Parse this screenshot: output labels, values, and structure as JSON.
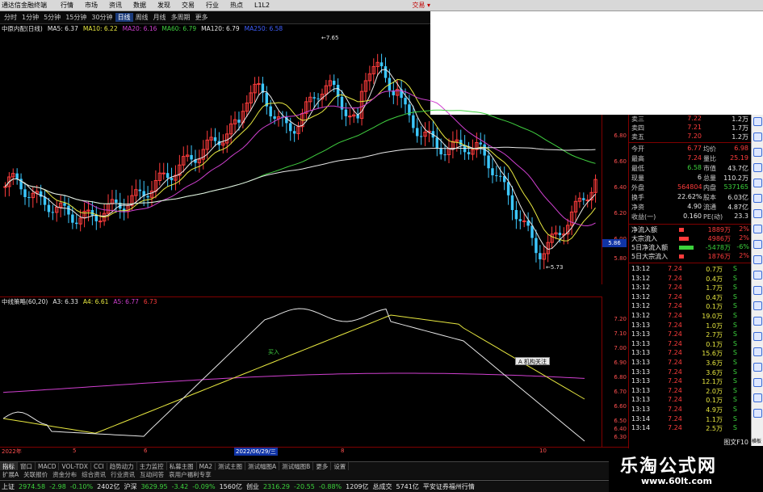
{
  "menubar": {
    "app_title": "通达信金融终端",
    "items": [
      "行情",
      "市场",
      "资讯",
      "数据",
      "发现",
      "交易",
      "行业",
      "热点",
      "L1L2"
    ],
    "right_label": "交易 ▾"
  },
  "periodbar": {
    "items": [
      "分时",
      "1分钟",
      "5分钟",
      "15分钟",
      "30分钟",
      "日线",
      "周线",
      "月线",
      "多周期",
      "更多"
    ],
    "active": "日线"
  },
  "main_legend": [
    {
      "text": "中原内配(日线)",
      "color": "#e8e8e8"
    },
    {
      "text": "MA5: 6.37",
      "color": "#e8e8e8"
    },
    {
      "text": "MA10: 6.22",
      "color": "#e8e840"
    },
    {
      "text": "MA20: 6.16",
      "color": "#d040d0"
    },
    {
      "text": "MA60: 6.79",
      "color": "#40d040"
    },
    {
      "text": "MA120: 6.79",
      "color": "#e8e8e8"
    },
    {
      "text": "MA250: 6.58",
      "color": "#4060ff"
    }
  ],
  "price_axis": [
    "6.80",
    "6.60",
    "6.40",
    "6.20",
    "6.00",
    "5.80"
  ],
  "price_current": "5.86",
  "annotations": {
    "high": "7.65",
    "low": "5.73"
  },
  "indicator_legend": [
    {
      "text": "中线策略(60,20)",
      "color": "#e8e8e8"
    },
    {
      "text": "A3: 6.33",
      "color": "#e8e8e8"
    },
    {
      "text": "A4: 6.61",
      "color": "#e8e840"
    },
    {
      "text": "A5: 6.77",
      "color": "#d040d0"
    },
    {
      "text": "6.73",
      "color": "#ff3c3c"
    }
  ],
  "indicator_axis": [
    "7.20",
    "7.10",
    "7.00",
    "6.90",
    "6.80",
    "6.70",
    "6.60",
    "6.50",
    "6.40",
    "6.30"
  ],
  "indicator_label": "买入",
  "popup_label": "A 机构关注",
  "date_axis": [
    {
      "text": "2022年",
      "highlight": false
    },
    {
      "text": "5",
      "highlight": false
    },
    {
      "text": "6",
      "highlight": false
    },
    {
      "text": "2022/06/29/三",
      "highlight": true
    },
    {
      "text": "8",
      "highlight": false
    },
    {
      "text": "10",
      "highlight": false
    }
  ],
  "tabbar1": [
    "指标",
    "窗口",
    "MACD",
    "VOL-TDX",
    "CCI",
    "趋势动力",
    "主力监控",
    "私募主图",
    "MA2",
    "测试主图",
    "测试幅图A",
    "测试幅图B",
    "更多",
    "设置"
  ],
  "tabbar2": [
    "扩展A",
    "关联报价",
    "资金分布",
    "综合资讯",
    "行业资讯",
    "互动问答",
    "哀用户福利专享"
  ],
  "quote": {
    "asks": [
      {
        "label": "卖三",
        "price": "7.22",
        "vol": "1.2万"
      },
      {
        "label": "卖四",
        "price": "7.21",
        "vol": "1.7万"
      },
      {
        "label": "卖五",
        "price": "7.20",
        "vol": "1.2万"
      }
    ],
    "stats": [
      {
        "l1": "今开",
        "v1": "6.77",
        "c1": "red",
        "l2": "均价",
        "v2": "6.98",
        "c2": "red"
      },
      {
        "l1": "最高",
        "v1": "7.24",
        "c1": "red",
        "l2": "量比",
        "v2": "25.19",
        "c2": "red"
      },
      {
        "l1": "最低",
        "v1": "6.58",
        "c1": "green",
        "l2": "市值",
        "v2": "43.7亿",
        "c2": "white"
      },
      {
        "l1": "现量",
        "v1": "6",
        "c1": "white",
        "l2": "总量",
        "v2": "110.2万",
        "c2": "white"
      },
      {
        "l1": "外盘",
        "v1": "564804",
        "c1": "red",
        "l2": "内盘",
        "v2": "537165",
        "c2": "green"
      },
      {
        "l1": "换手",
        "v1": "22.62%",
        "c1": "white",
        "l2": "股本",
        "v2": "6.03亿",
        "c2": "white"
      },
      {
        "l1": "净资",
        "v1": "4.90",
        "c1": "white",
        "l2": "流通",
        "v2": "4.87亿",
        "c2": "white"
      },
      {
        "l1": "收益(一)",
        "v1": "0.160",
        "c1": "white",
        "l2": "PE(动)",
        "v2": "23.3",
        "c2": "white"
      }
    ],
    "flows": [
      {
        "label": "净流入额",
        "value": "1889万",
        "pct": "2%",
        "color": "red",
        "bar": 0.3
      },
      {
        "label": "大宗流入",
        "value": "4986万",
        "pct": "2%",
        "color": "red",
        "bar": 0.6
      },
      {
        "label": "5日净流入额",
        "value": "-5478万",
        "pct": "-6%",
        "color": "green",
        "bar": 0.9
      },
      {
        "label": "5日大宗流入",
        "value": "1876万",
        "pct": "2%",
        "color": "red",
        "bar": 0.3
      }
    ],
    "ticks": [
      {
        "time": "13:12",
        "price": "7.24",
        "vol": "0.7万",
        "side": "S"
      },
      {
        "time": "13:12",
        "price": "7.24",
        "vol": "0.4万",
        "side": "S"
      },
      {
        "time": "13:12",
        "price": "7.24",
        "vol": "1.7万",
        "side": "S"
      },
      {
        "time": "13:12",
        "price": "7.24",
        "vol": "0.4万",
        "side": "S"
      },
      {
        "time": "13:12",
        "price": "7.24",
        "vol": "0.1万",
        "side": "S"
      },
      {
        "time": "13:12",
        "price": "7.24",
        "vol": "19.0万",
        "side": "S"
      },
      {
        "time": "13:13",
        "price": "7.24",
        "vol": "1.0万",
        "side": "S"
      },
      {
        "time": "13:13",
        "price": "7.24",
        "vol": "2.7万",
        "side": "S"
      },
      {
        "time": "13:13",
        "price": "7.24",
        "vol": "0.1万",
        "side": "S"
      },
      {
        "time": "13:13",
        "price": "7.24",
        "vol": "15.6万",
        "side": "S"
      },
      {
        "time": "13:13",
        "price": "7.24",
        "vol": "3.6万",
        "side": "S"
      },
      {
        "time": "13:13",
        "price": "7.24",
        "vol": "3.6万",
        "side": "S"
      },
      {
        "time": "13:13",
        "price": "7.24",
        "vol": "12.1万",
        "side": "S"
      },
      {
        "time": "13:13",
        "price": "7.24",
        "vol": "2.0万",
        "side": "S"
      },
      {
        "time": "13:13",
        "price": "7.24",
        "vol": "0.1万",
        "side": "S"
      },
      {
        "time": "13:13",
        "price": "7.24",
        "vol": "4.9万",
        "side": "S"
      },
      {
        "time": "13:14",
        "price": "7.24",
        "vol": "1.1万",
        "side": "S"
      },
      {
        "time": "13:14",
        "price": "7.24",
        "vol": "2.5万",
        "side": "S"
      }
    ],
    "footer": "图文F10"
  },
  "side_tools": [
    "tool-1",
    "tool-2",
    "tool-3",
    "tool-4",
    "tool-5",
    "tool-6",
    "tool-7",
    "tool-8",
    "tool-9",
    "tool-10",
    "tool-11",
    "tool-12",
    "tool-13",
    "tool-14",
    "tool-15",
    "tool-16",
    "tool-17",
    "tool-18",
    "tool-19",
    "tool-20"
  ],
  "side_label": "横板",
  "statusbar": [
    {
      "text": "上证",
      "color": "white"
    },
    {
      "text": "2974.58",
      "color": "green"
    },
    {
      "text": "-2.98",
      "color": "green"
    },
    {
      "text": "-0.10%",
      "color": "green"
    },
    {
      "text": "2402亿",
      "color": "white"
    },
    {
      "text": "沪深",
      "color": "white"
    },
    {
      "text": "3629.95",
      "color": "green"
    },
    {
      "text": "-3.42",
      "color": "green"
    },
    {
      "text": "-0.09%",
      "color": "green"
    },
    {
      "text": "1560亿",
      "color": "white"
    },
    {
      "text": "创业",
      "color": "white"
    },
    {
      "text": "2316.29",
      "color": "green"
    },
    {
      "text": "-20.55",
      "color": "green"
    },
    {
      "text": "-0.88%",
      "color": "green"
    },
    {
      "text": "1209亿",
      "color": "white"
    },
    {
      "text": "总成交",
      "color": "white"
    },
    {
      "text": "5741亿",
      "color": "white"
    },
    {
      "text": "平安证券福州行情",
      "color": "white"
    }
  ],
  "watermark": {
    "big": "乐淘公式网",
    "small": "www.60lt.com"
  },
  "colors": {
    "up": "#3cc8c8",
    "down": "#3cc8ff",
    "ma5": "#e8e8e8",
    "ma10": "#e8e840",
    "ma20": "#d040d0",
    "ma60": "#40d040",
    "ma120": "#e8e8e8"
  }
}
